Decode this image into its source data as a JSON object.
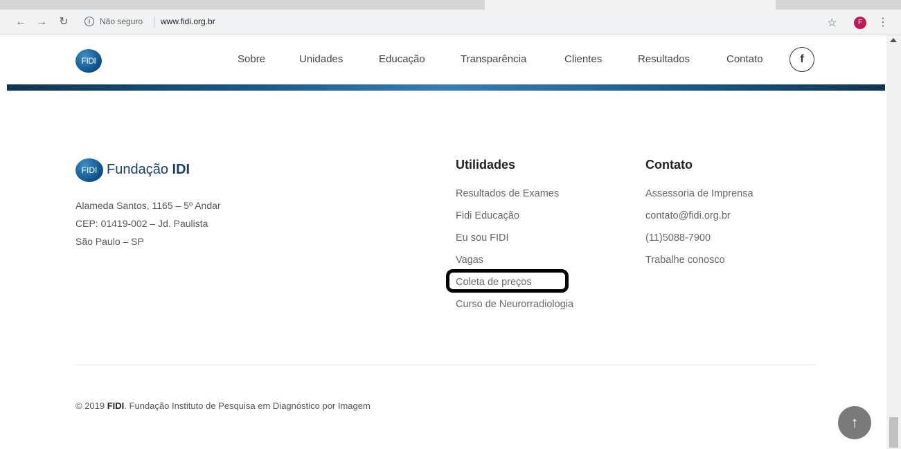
{
  "browser": {
    "security_label": "Não seguro",
    "url": "www.fidi.org.br",
    "profile_initial": "F"
  },
  "header": {
    "logo_text": "FIDI",
    "nav": [
      "Sobre",
      "Unidades",
      "Educação",
      "Transparência",
      "Clientes",
      "Resultados",
      "Contato"
    ],
    "facebook_glyph": "f"
  },
  "footer": {
    "logo_text": "FIDI",
    "brand_part1": "Fundação ",
    "brand_part2": "IDI",
    "address": [
      "Alameda Santos, 1165 – 5º Andar",
      "CEP: 01419-002 – Jd. Paulista",
      "São Paulo – SP"
    ],
    "utilidades": {
      "title": "Utilidades",
      "links": [
        "Resultados de Exames",
        "Fidi Educação",
        "Eu sou FIDI",
        "Vagas",
        "Coleta de preços",
        "Curso de Neurorradiologia"
      ]
    },
    "contato": {
      "title": "Contato",
      "links": [
        "Assessoria de Imprensa",
        "contato@fidi.org.br",
        "(11)5088-7900",
        "Trabalhe conosco"
      ]
    },
    "copyright_prefix": "© 2019 ",
    "copyright_brand": "FIDI",
    "copyright_suffix": ". Fundação Instituto de Pesquisa em Diagnóstico por Imagem"
  },
  "icons": {
    "back": "back-arrow-icon",
    "forward": "forward-arrow-icon",
    "reload": "reload-icon",
    "info": "info-icon",
    "star": "star-icon",
    "menu": "kebab-menu-icon",
    "facebook": "facebook-icon",
    "scroll_top": "arrow-up-icon"
  }
}
